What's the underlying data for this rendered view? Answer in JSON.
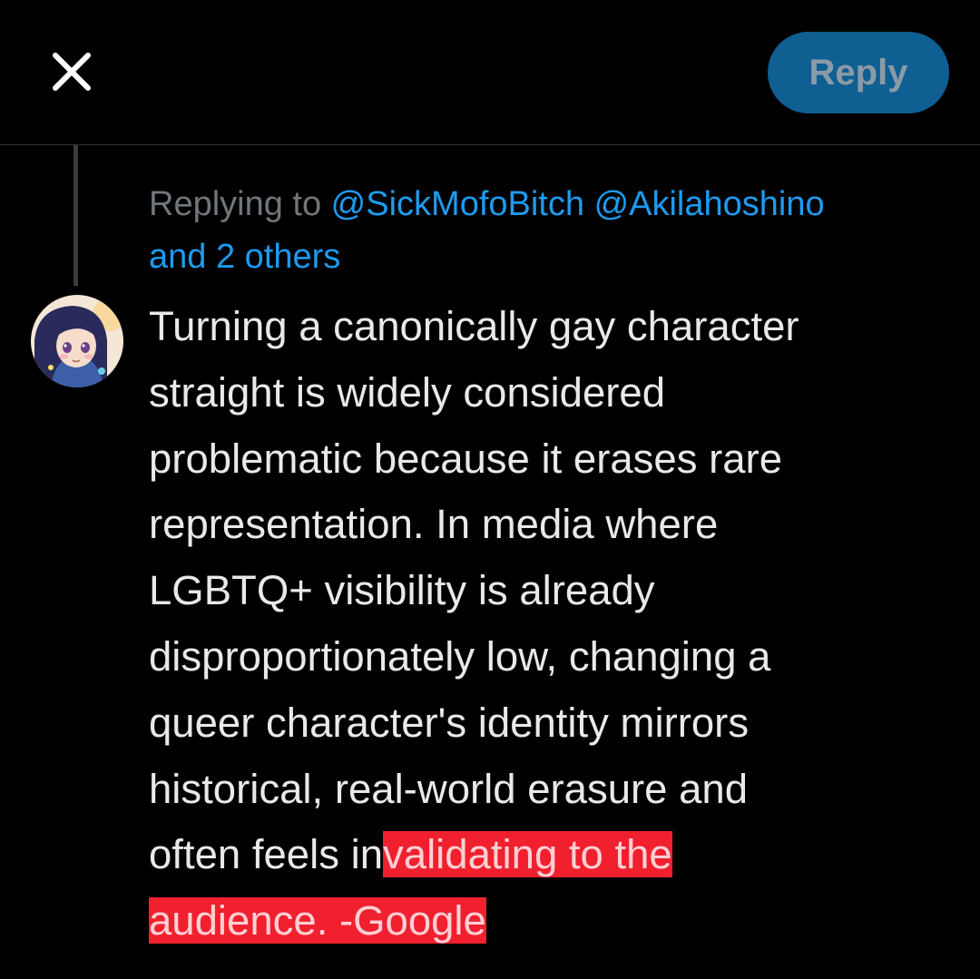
{
  "header": {
    "close_icon": "close-icon",
    "reply_label": "Reply"
  },
  "reply_context": {
    "prefix": "Replying to ",
    "mention_1": "@SickMofoBitch",
    "mention_2": "@Akilahoshino",
    "others": "and 2 others"
  },
  "tweet": {
    "avatar_icon": "user-avatar",
    "text_normal": "Turning a canonically gay character\nstraight is widely considered\nproblematic because it erases rare\nrepresentation. In media where\nLGBTQ+ visibility is already\ndisproportionately low, changing a\nqueer character's identity mirrors\nhistorical, real-world erasure and\noften feels in",
    "text_highlighted_1": "validating to the",
    "text_highlighted_2": "audience. -Google"
  },
  "colors": {
    "background": "#000000",
    "reply_button_bg": "#0f5f93",
    "reply_button_text": "#8a9aa6",
    "mention": "#1d9bf0",
    "muted_text": "#71767b",
    "body_text": "#e7e9ea",
    "highlight": "#f0202e"
  }
}
